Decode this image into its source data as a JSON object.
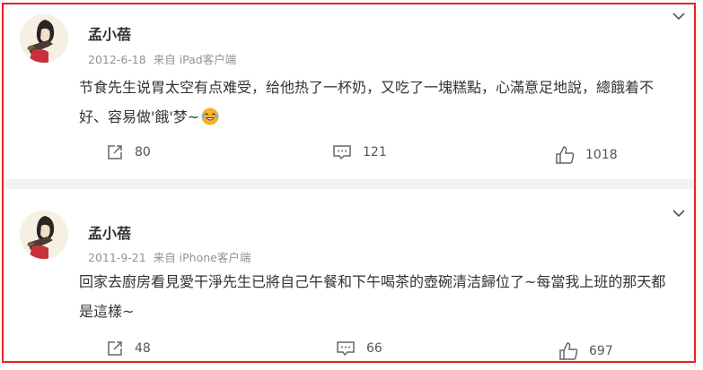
{
  "posts": [
    {
      "author": "孟小蓓",
      "date": "2012-6-18",
      "source": "来自 iPad客户端",
      "text": "节食先生说胃太空有点难受，给他热了一杯奶，又吃了一塊糕點，心滿意足地說，總餓着不好、容易做'餓'梦~",
      "emoji": "laughing-tears",
      "reposts": "80",
      "comments": "121",
      "likes": "1018"
    },
    {
      "author": "孟小蓓",
      "date": "2011-9-21",
      "source": "来自 iPhone客户端",
      "text": "回家去廚房看見愛干淨先生已將自己午餐和下午喝茶的壺碗清洁歸位了~每當我上班的那天都是這樣~",
      "reposts": "48",
      "comments": "66",
      "likes": "697"
    }
  ],
  "colors": {
    "frame": "#e8211f",
    "text": "#333333",
    "meta": "#939393",
    "separator": "#f2f2f2"
  }
}
